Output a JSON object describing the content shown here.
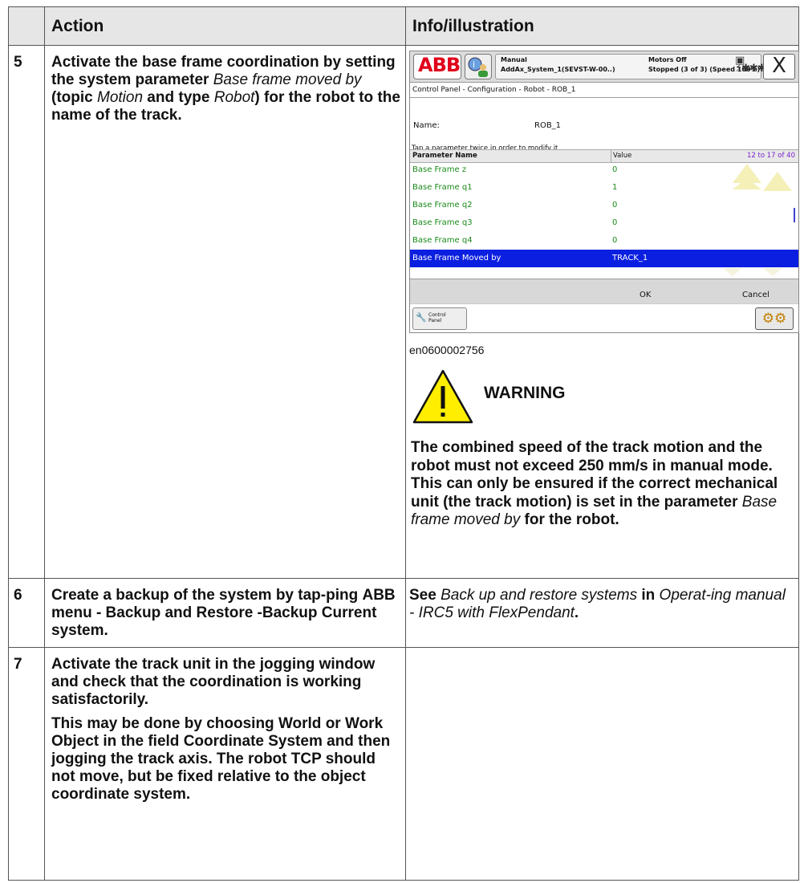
{
  "table": {
    "header_action": "Action",
    "header_info": "Info/illustration"
  },
  "step5": {
    "num": "5",
    "action_1": "Activate the base frame coordination by setting the system parameter ",
    "action_param": "Base frame moved by",
    "action_2": " (topic ",
    "action_topic": "Motion",
    "action_3": " and type ",
    "action_type": "Robot",
    "action_4": ") for the robot to the name of the track.",
    "caption": "en0600002756",
    "warning_title": "WARNING",
    "warning_text_1": "The combined speed of the track motion and the robot must not exceed 250 mm/s in manual mode. This can only be ensured if the correct mechanical unit (the track motion) is set in the parameter ",
    "warning_param": "Base frame moved by",
    "warning_text_2": " for the robot."
  },
  "flexpendant": {
    "logo": "ABB",
    "status_mode": "Manual",
    "status_system": "AddAx_System_1(SEVST-W-00..)",
    "status_motors": "Motors Off",
    "status_state": "Stopped (3 of 3) (Speed 100%)",
    "close_glyph": "X",
    "breadcrumb": "Control Panel - Configuration - Robot - ROB_1",
    "name_label": "Name:",
    "name_value": "ROB_1",
    "hint": "Tap a parameter twice in order to modify it.",
    "col_name": "Parameter Name",
    "col_value": "Value",
    "paging": "12 to 17 of 40",
    "rows": [
      {
        "name": "Base Frame z",
        "value": "0"
      },
      {
        "name": "Base Frame q1",
        "value": "1"
      },
      {
        "name": "Base Frame q2",
        "value": "0"
      },
      {
        "name": "Base Frame q3",
        "value": "0"
      },
      {
        "name": "Base Frame q4",
        "value": "0"
      },
      {
        "name": "Base Frame Moved by",
        "value": "TRACK_1"
      }
    ],
    "ok_label": "OK",
    "cancel_label": "Cancel",
    "control_panel_line1": "Control",
    "control_panel_line2": "Panel"
  },
  "step6": {
    "num": "6",
    "action_1": "Create a backup of the system by tap-ping ",
    "action_bold": "ABB menu - Backup and Restore -Backup Current system",
    "action_2": ".",
    "info_1": "See ",
    "info_ref1": "Back up and restore systems",
    "info_2": " in ",
    "info_ref2": "Operat-ing manual - IRC5 with FlexPendant",
    "info_3": "."
  },
  "step7": {
    "num": "7",
    "para1": "Activate the track unit in the jogging window and check that the coordination is working satisfactorily.",
    "p2_1": "This may be done by choosing ",
    "p2_world": "World",
    "p2_2": " or ",
    "p2_wobj": "Work Object",
    "p2_3": " in the field ",
    "p2_cs": "Coordinate System",
    "p2_4": " and then jogging the track axis. The robot TCP should not move, but be fixed relative to the object coordinate system."
  },
  "colors": {
    "selected_row": "#0b1fe0",
    "param_text": "#1a8a1a",
    "abb_red": "#e0001a",
    "warning_yellow": "#ffee00"
  }
}
